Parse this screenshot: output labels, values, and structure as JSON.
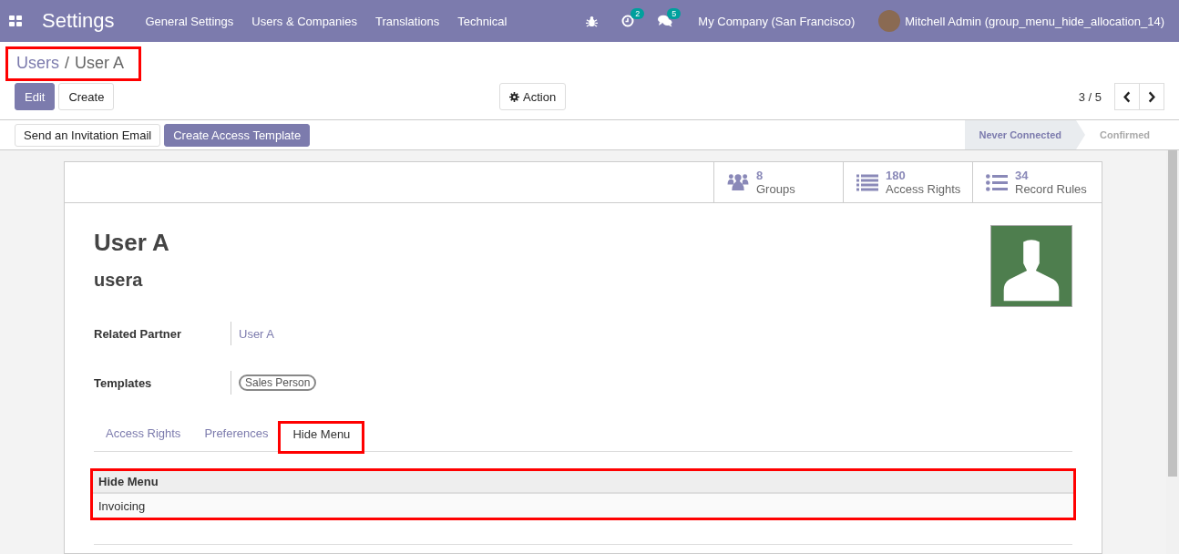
{
  "navbar": {
    "app_name": "Settings",
    "menus": [
      "General Settings",
      "Users & Companies",
      "Translations",
      "Technical"
    ],
    "activity_count": "2",
    "message_count": "5",
    "company": "My Company (San Francisco)",
    "user": "Mitchell Admin (group_menu_hide_allocation_14)"
  },
  "breadcrumb": {
    "items": [
      {
        "label": "Users",
        "kind": "link"
      },
      {
        "label": "User A",
        "kind": "current"
      }
    ],
    "separator": "/",
    "highlighted": true
  },
  "buttons": [
    {
      "label": "Edit",
      "kind": "primary"
    },
    {
      "label": "Create",
      "kind": "secondary"
    }
  ],
  "action_button": "Action",
  "pager": "3 / 5",
  "header_buttons": [
    {
      "label": "Send an Invitation Email",
      "kind": "secondary"
    },
    {
      "label": "Create Access Template",
      "kind": "primary"
    }
  ],
  "status_steps": [
    {
      "label": "Never Connected",
      "selected": true
    },
    {
      "label": "Confirmed",
      "selected": false
    }
  ],
  "stat_buttons": [
    {
      "kind": "groups",
      "count": "8",
      "label": "Groups"
    },
    {
      "kind": "list",
      "count": "180",
      "label": "Access Rights"
    },
    {
      "kind": "bullets",
      "count": "34",
      "label": "Record Rules"
    }
  ],
  "name": "User A",
  "login": "usera",
  "fields": [
    {
      "label": "Related Partner",
      "kind": "link",
      "value": "User A"
    },
    {
      "label": "Templates",
      "kind": "tags",
      "tags": [
        "Sales Person"
      ]
    }
  ],
  "tabs": [
    {
      "label": "Access Rights",
      "selected": false,
      "highlighted": false
    },
    {
      "label": "Preferences",
      "selected": false,
      "highlighted": false
    },
    {
      "label": "Hide Menu",
      "selected": true,
      "highlighted": true
    }
  ],
  "hide_menu_table": {
    "columns": [
      "Hide Menu"
    ],
    "rows": [
      [
        "Invoicing"
      ]
    ],
    "highlighted": true
  }
}
